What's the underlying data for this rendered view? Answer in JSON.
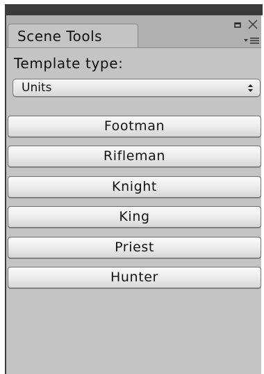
{
  "panel": {
    "tab_title": "Scene Tools",
    "icons": {
      "maximize": "maximize-icon",
      "close": "close-icon",
      "menu": "menu-icon"
    }
  },
  "template": {
    "label": "Template type:",
    "selected": "Units",
    "arrow_icon": "dropdown-arrows-icon"
  },
  "buttons": [
    {
      "name": "footman-button",
      "label": "Footman"
    },
    {
      "name": "rifleman-button",
      "label": "Rifleman"
    },
    {
      "name": "knight-button",
      "label": "Knight"
    },
    {
      "name": "king-button",
      "label": "King"
    },
    {
      "name": "priest-button",
      "label": "Priest"
    },
    {
      "name": "hunter-button",
      "label": "Hunter"
    }
  ],
  "colors": {
    "panel_background": "#c4c4c4",
    "tab_strip": "#b0b0b0",
    "title_bar": "#3a3a3a"
  }
}
